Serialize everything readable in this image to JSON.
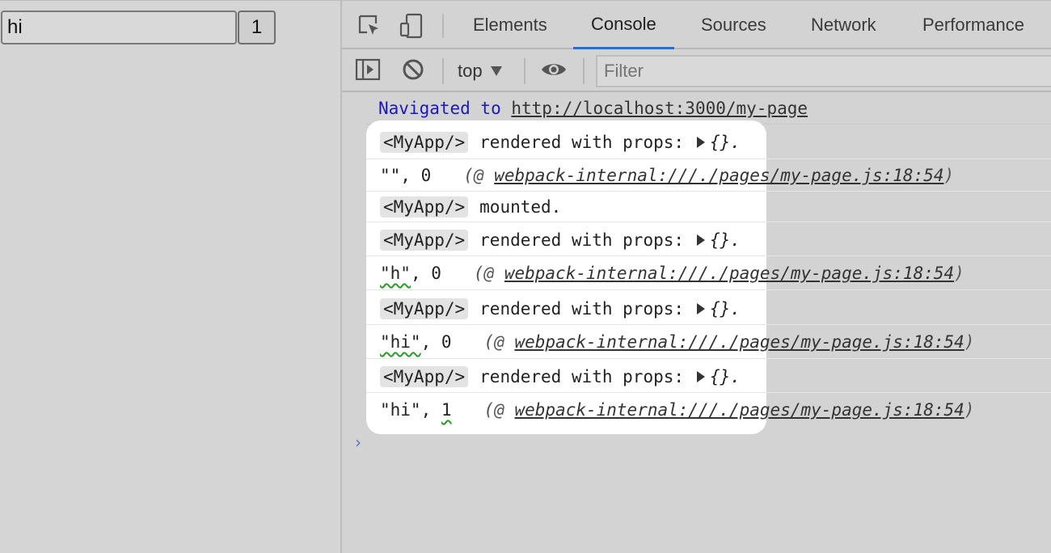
{
  "page": {
    "input_value": "hi",
    "button_label": "1"
  },
  "devtools": {
    "tabs": [
      "Elements",
      "Console",
      "Sources",
      "Network",
      "Performance"
    ],
    "active_tab": "Console",
    "toolbar": {
      "context": "top",
      "filter_placeholder": "Filter"
    },
    "navigated": {
      "prefix": "Navigated to",
      "url": "http://localhost:3000/my-page"
    },
    "log": {
      "component": "<MyApp/>",
      "rendered_msg": "rendered with props:",
      "props_obj": "{}.",
      "mounted_msg": "mounted.",
      "src_open": "(@ ",
      "src_link": "webpack-internal:///./pages/my-page.js:18:54",
      "src_close": ")",
      "val_empty": "\"\"",
      "val_h": "\"h\"",
      "val_hi": "\"hi\"",
      "comma": ",",
      "zero": "0",
      "one": "1"
    },
    "prompt": "›"
  }
}
